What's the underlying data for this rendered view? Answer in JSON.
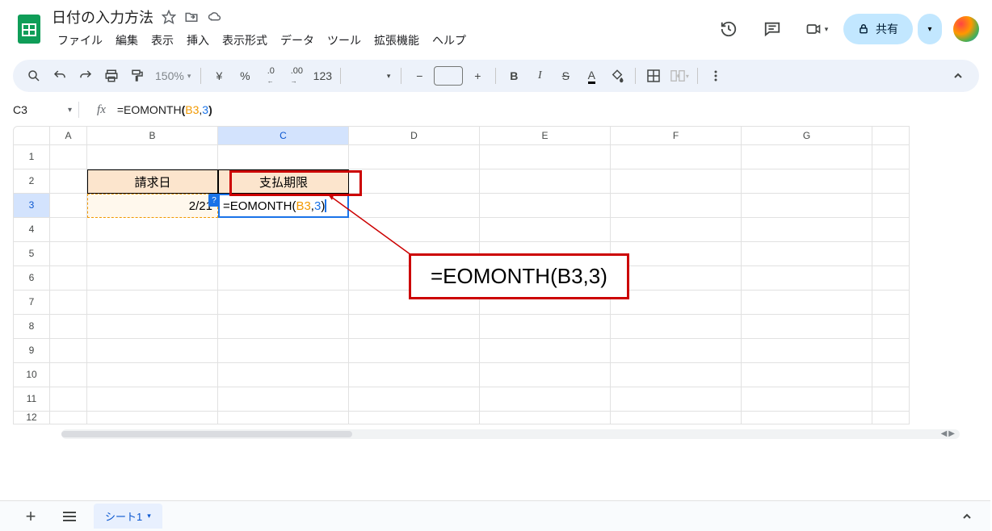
{
  "doc": {
    "title": "日付の入力方法"
  },
  "menu": {
    "file": "ファイル",
    "edit": "編集",
    "view": "表示",
    "insert": "挿入",
    "format": "表示形式",
    "data": "データ",
    "tools": "ツール",
    "extensions": "拡張機能",
    "help": "ヘルプ"
  },
  "share": {
    "label": "共有"
  },
  "toolbar": {
    "zoom": "150%",
    "currency": "¥",
    "percent": "%",
    "dec_dec": ".0",
    "dec_inc": ".00",
    "numfmt": "123"
  },
  "namebox": {
    "value": "C3"
  },
  "formula": {
    "prefix": "=EOMONTH",
    "open": "(",
    "ref": "B3",
    "comma": ",",
    "num": "3",
    "close": ")"
  },
  "columns": {
    "a": "A",
    "b": "B",
    "c": "C",
    "d": "D",
    "e": "E",
    "f": "F",
    "g": "G"
  },
  "rows": {
    "r1": "1",
    "r2": "2",
    "r3": "3",
    "r4": "4",
    "r5": "5",
    "r6": "6",
    "r7": "7",
    "r8": "8",
    "r9": "9",
    "r10": "10",
    "r11": "11",
    "r12": "12"
  },
  "cells": {
    "b2": "請求日",
    "c2": "支払期限",
    "b3": "2/21",
    "c3_prefix": "=EOMONTH",
    "c3_open": "(",
    "c3_ref": "B3",
    "c3_comma": ",",
    "c3_num": "3",
    "c3_close": ")",
    "help": "?"
  },
  "annotation": {
    "text": "=EOMONTH(B3,3)"
  },
  "tabs": {
    "sheet1": "シート1"
  }
}
